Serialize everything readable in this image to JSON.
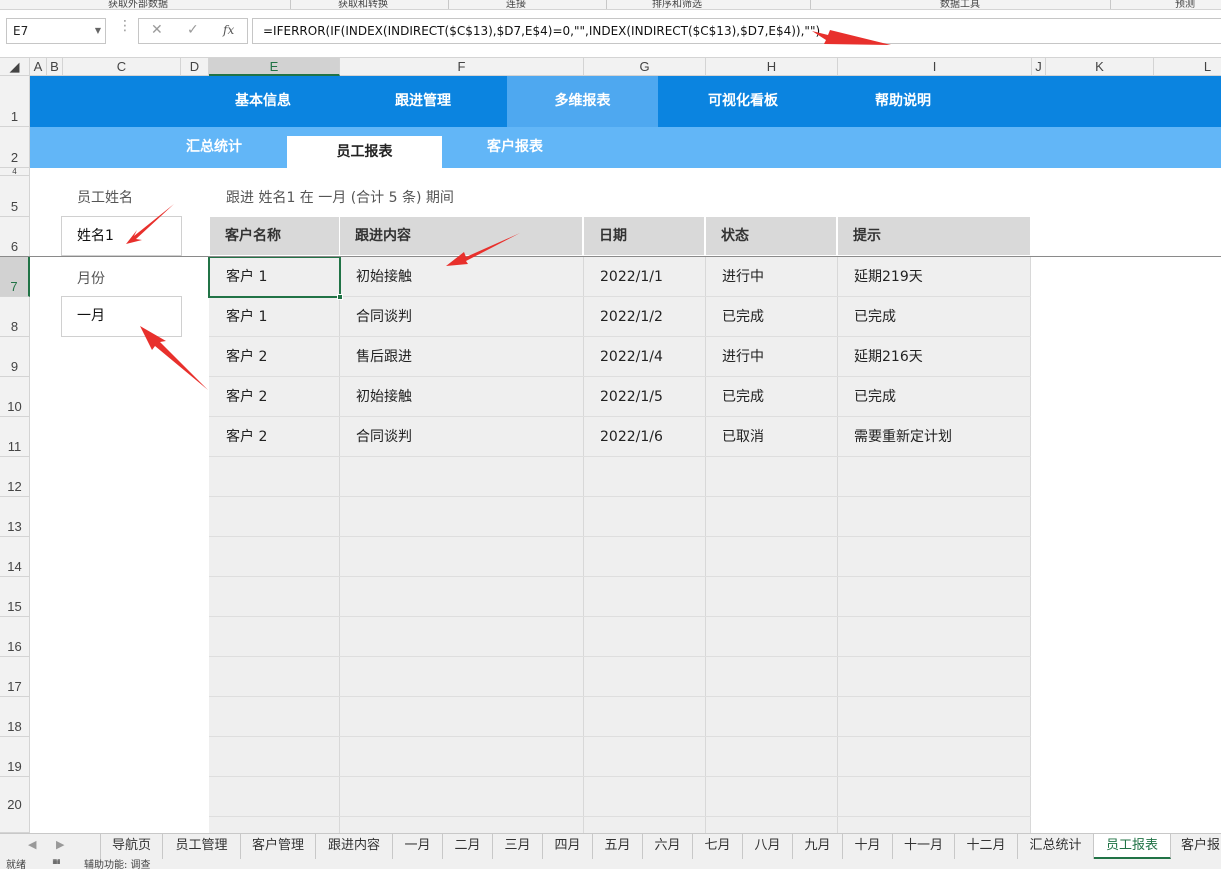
{
  "ribbon": {
    "groups": [
      "获取外部数据",
      "获取和转换",
      "连接",
      "排序和筛选",
      "数据工具",
      "预测"
    ]
  },
  "formula_bar": {
    "name_box": "E7",
    "cancel_glyph": "✕",
    "enter_glyph": "✓",
    "fx_label": "fx",
    "formula": "=IFERROR(IF(INDEX(INDIRECT($C$13),$D7,E$4)=0,\"\",INDEX(INDIRECT($C$13),$D7,E$4)),\"\")"
  },
  "columns": [
    "A",
    "B",
    "C",
    "D",
    "E",
    "F",
    "G",
    "H",
    "I",
    "J",
    "K",
    "L"
  ],
  "rows": [
    "1",
    "2",
    "4",
    "5",
    "6",
    "7",
    "8",
    "9",
    "10",
    "11",
    "12",
    "13",
    "14",
    "15",
    "16",
    "17",
    "18",
    "19",
    "20"
  ],
  "nav_main": {
    "items": [
      "基本信息",
      "跟进管理",
      "多维报表",
      "可视化看板",
      "帮助说明"
    ],
    "active": "多维报表"
  },
  "nav_sub": {
    "items": [
      "汇总统计",
      "员工报表",
      "客户报表"
    ],
    "active": "员工报表"
  },
  "filters": {
    "employee_label": "员工姓名",
    "employee_value": "姓名1",
    "month_label": "月份",
    "month_value": "一月"
  },
  "summary_text": "跟进 姓名1 在 一月 (合计 5 条) 期间",
  "table": {
    "headers": [
      "客户名称",
      "跟进内容",
      "日期",
      "状态",
      "提示"
    ],
    "rows": [
      [
        "客户 1",
        "初始接触",
        "2022/1/1",
        "进行中",
        "延期219天"
      ],
      [
        "客户 1",
        "合同谈判",
        "2022/1/2",
        "已完成",
        "已完成"
      ],
      [
        "客户 2",
        "售后跟进",
        "2022/1/4",
        "进行中",
        "延期216天"
      ],
      [
        "客户 2",
        "初始接触",
        "2022/1/5",
        "已完成",
        "已完成"
      ],
      [
        "客户 2",
        "合同谈判",
        "2022/1/6",
        "已取消",
        "需要重新定计划"
      ]
    ]
  },
  "sheet_tabs": {
    "items": [
      "导航页",
      "员工管理",
      "客户管理",
      "跟进内容",
      "一月",
      "二月",
      "三月",
      "四月",
      "五月",
      "六月",
      "七月",
      "八月",
      "九月",
      "十月",
      "十一月",
      "十二月",
      "汇总统计",
      "员工报表",
      "客户报"
    ],
    "active": "员工报表"
  },
  "status_bar": {
    "left": "就绪",
    "macro": "辅助功能: 调查"
  },
  "colors": {
    "nav_main": "#0b84e0",
    "nav_sub": "#62b6f7",
    "excel_green": "#217346",
    "annotation_arrow": "#e8302c"
  }
}
